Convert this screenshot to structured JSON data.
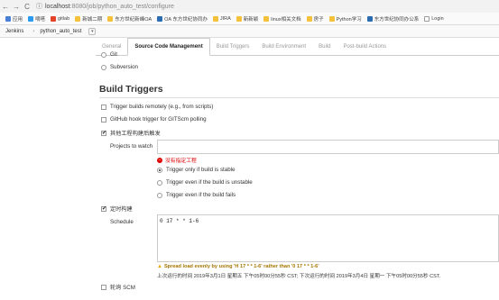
{
  "browser": {
    "back": "←",
    "forward": "→",
    "reload": "C",
    "info": "ⓘ",
    "url_host": "localhost",
    "url_path": ":8080/job/python_auto_test/configure"
  },
  "bookmarks": [
    {
      "label": "应用",
      "color": "#4a7fd6"
    },
    {
      "label": "嘀嗒",
      "color": "#2a9cf0"
    },
    {
      "label": "gitlab",
      "color": "#e24329"
    },
    {
      "label": "新城二期",
      "color": "#f4c13a"
    },
    {
      "label": "东方世纪新峰OA",
      "color": "#f4c13a"
    },
    {
      "label": "OA 东方世纪协同办",
      "color": "#2b6cb0"
    },
    {
      "label": "JIRA",
      "color": "#f4c13a"
    },
    {
      "label": "新新颖",
      "color": "#f4c13a"
    },
    {
      "label": "linux相关文档",
      "color": "#f4c13a"
    },
    {
      "label": "房子",
      "color": "#f4c13a"
    },
    {
      "label": "Python学习",
      "color": "#f4c13a"
    },
    {
      "label": "东方世纪协同办公系",
      "color": "#2b6cb0"
    },
    {
      "label": "Login",
      "color": "#ffffff"
    }
  ],
  "breadcrumbs": {
    "root": "Jenkins",
    "job": "python_auto_test"
  },
  "tabs": [
    "General",
    "Source Code Management",
    "Build Triggers",
    "Build Environment",
    "Build",
    "Post-build Actions"
  ],
  "scm": {
    "git": "Git",
    "subversion": "Subversion"
  },
  "build_triggers": {
    "heading": "Build Triggers",
    "remote": "Trigger builds remotely (e.g., from scripts)",
    "github": "GitHub hook trigger for GITScm polling",
    "after_other": "其他工程构建后触发",
    "projects_label": "Projects to watch",
    "projects_value": "",
    "error": "没有指定工程",
    "stable": "Trigger only if build is stable",
    "unstable": "Trigger even if the build is unstable",
    "fails": "Trigger even if the build fails",
    "periodic": "定时构建",
    "schedule_label": "Schedule",
    "schedule_value": "0 17 * * 1-6",
    "warning": "Spread load evenly by using 'H 17 * * 1-6' rather than '0 17 * * 1-6'",
    "next_run": "上次运行的时间 2019年3月1日 星期五 下午05时00分55秒 CST; 下次运行的时间 2019年3月4日 星期一 下午05时00分55秒 CST.",
    "poll_scm": "轮询 SCM"
  }
}
